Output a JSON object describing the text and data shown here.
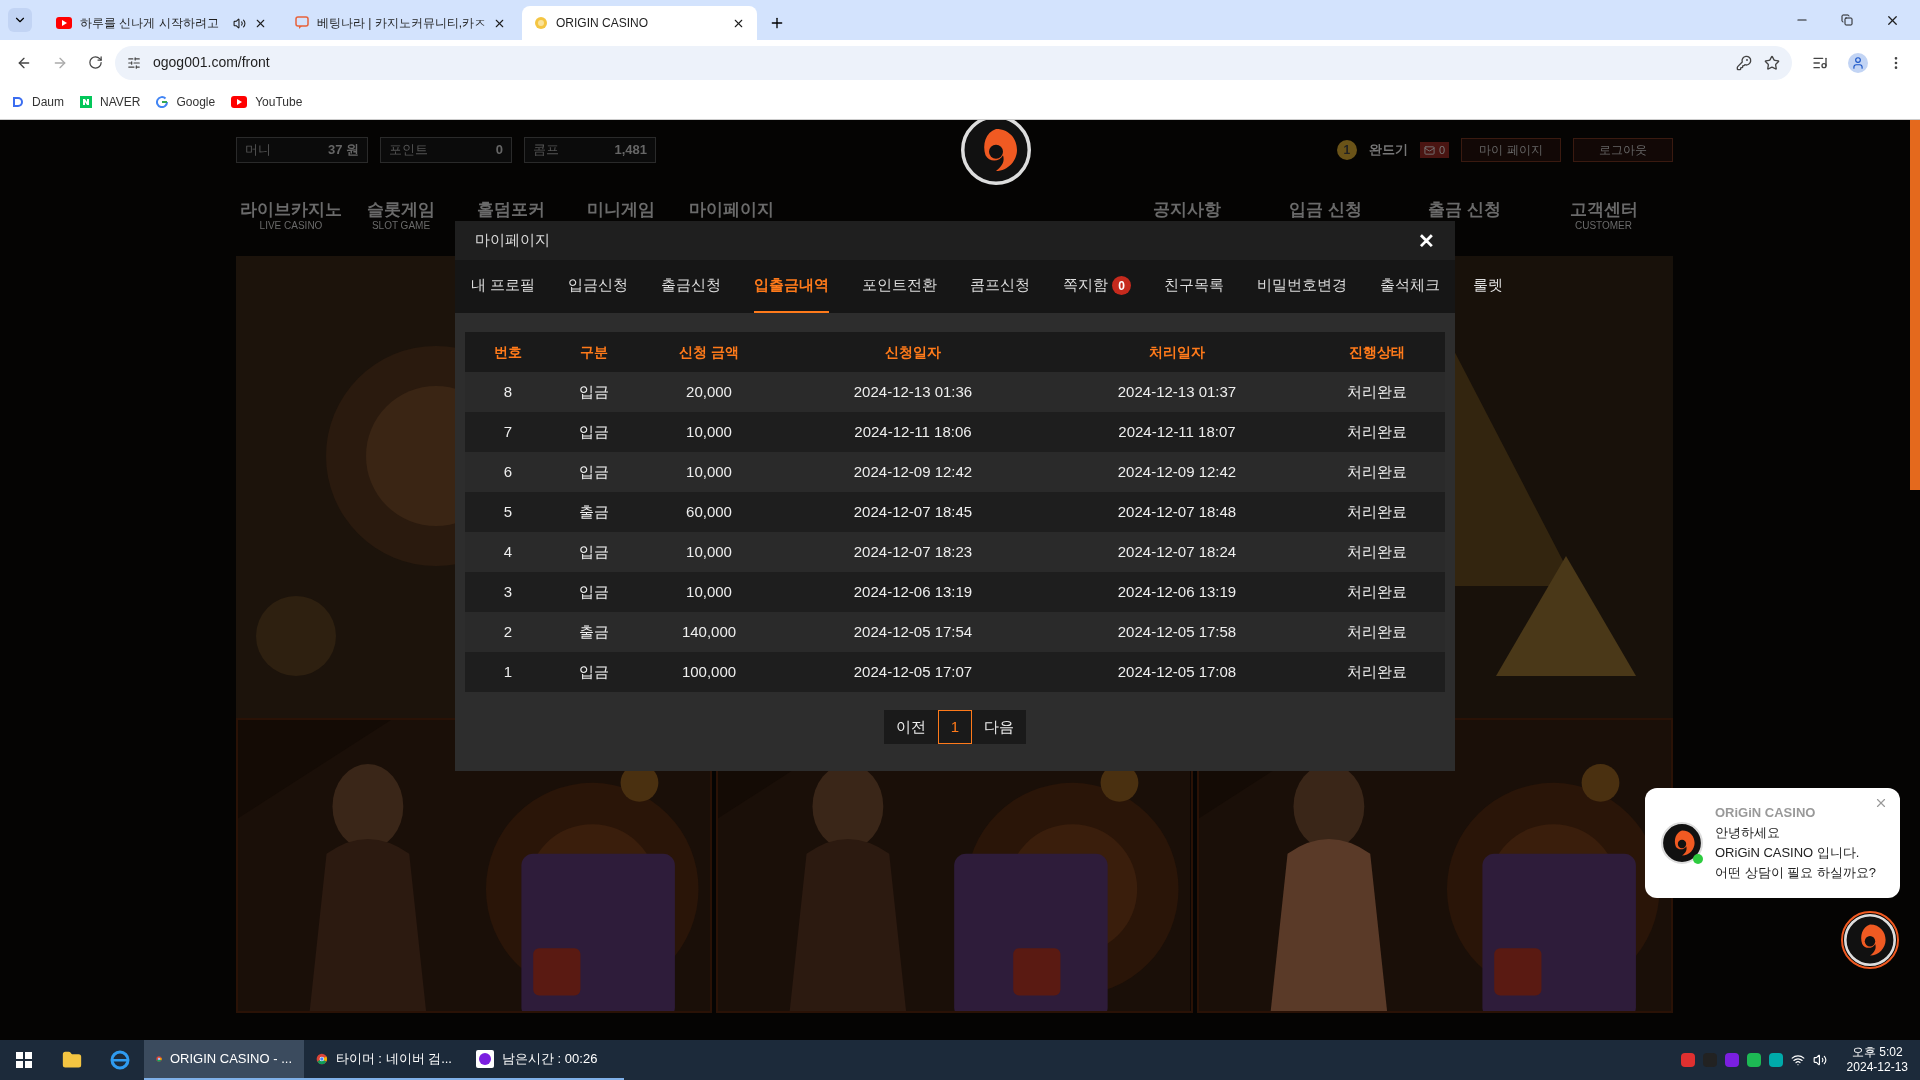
{
  "browser": {
    "tabs": [
      {
        "title": "하루를 신나게 시작하려고",
        "selected": false,
        "kind": "youtube",
        "audio": true
      },
      {
        "title": "베팅나라 | 카지노커뮤니티,카ㅈ",
        "selected": false,
        "kind": "chat",
        "audio": false
      },
      {
        "title": "ORIGIN CASINO",
        "selected": true,
        "kind": "globe",
        "audio": false
      }
    ],
    "url": "ogog001.com/front",
    "bookmarks": [
      {
        "label": "Daum",
        "kind": "daum"
      },
      {
        "label": "NAVER",
        "kind": "naver"
      },
      {
        "label": "Google",
        "kind": "google"
      },
      {
        "label": "YouTube",
        "kind": "youtube"
      }
    ]
  },
  "site": {
    "wallet": [
      {
        "label": "머니",
        "value": "37 원"
      },
      {
        "label": "포인트",
        "value": "0"
      },
      {
        "label": "콤프",
        "value": "1,481"
      }
    ],
    "user": {
      "level": "1",
      "name": "완드기",
      "messages": "0"
    },
    "account_buttons": [
      "마이 페이지",
      "로그아웃"
    ],
    "nav_left": [
      {
        "label": "라이브카지노",
        "sub": "LIVE CASINO"
      },
      {
        "label": "슬롯게임",
        "sub": "SLOT GAME"
      },
      {
        "label": "홀덤포커"
      },
      {
        "label": "미니게임"
      },
      {
        "label": "마이페이지"
      }
    ],
    "nav_right": [
      {
        "label": "공지사항"
      },
      {
        "label": "입금 신청"
      },
      {
        "label": "출금 신청"
      },
      {
        "label": "고객센터",
        "sub": "CUSTOMER"
      }
    ]
  },
  "modal": {
    "title": "마이페이지",
    "close": "✕",
    "tabs": [
      {
        "label": "내 프로필",
        "selected": false
      },
      {
        "label": "입금신청",
        "selected": false
      },
      {
        "label": "출금신청",
        "selected": false
      },
      {
        "label": "입출금내역",
        "selected": true
      },
      {
        "label": "포인트전환",
        "selected": false
      },
      {
        "label": "콤프신청",
        "selected": false
      },
      {
        "label": "쪽지함",
        "selected": false,
        "badge": "0"
      },
      {
        "label": "친구목록",
        "selected": false
      },
      {
        "label": "비밀번호변경",
        "selected": false
      },
      {
        "label": "출석체크",
        "selected": false
      },
      {
        "label": "룰렛",
        "selected": false
      }
    ],
    "table": {
      "columns": [
        "번호",
        "구분",
        "신청 금액",
        "신청일자",
        "처리일자",
        "진행상태"
      ],
      "rows": [
        [
          "8",
          "입금",
          "20,000",
          "2024-12-13 01:36",
          "2024-12-13 01:37",
          "처리완료"
        ],
        [
          "7",
          "입금",
          "10,000",
          "2024-12-11 18:06",
          "2024-12-11 18:07",
          "처리완료"
        ],
        [
          "6",
          "입금",
          "10,000",
          "2024-12-09 12:42",
          "2024-12-09 12:42",
          "처리완료"
        ],
        [
          "5",
          "출금",
          "60,000",
          "2024-12-07 18:45",
          "2024-12-07 18:48",
          "처리완료"
        ],
        [
          "4",
          "입금",
          "10,000",
          "2024-12-07 18:23",
          "2024-12-07 18:24",
          "처리완료"
        ],
        [
          "3",
          "입금",
          "10,000",
          "2024-12-06 13:19",
          "2024-12-06 13:19",
          "처리완료"
        ],
        [
          "2",
          "출금",
          "140,000",
          "2024-12-05 17:54",
          "2024-12-05 17:58",
          "처리완료"
        ],
        [
          "1",
          "입금",
          "100,000",
          "2024-12-05 17:07",
          "2024-12-05 17:08",
          "처리완료"
        ]
      ]
    },
    "pagination": {
      "prev": "이전",
      "pages": [
        {
          "label": "1",
          "selected": true
        }
      ],
      "next": "다음"
    }
  },
  "chat": {
    "name": "ORiGiN CASINO",
    "lines": [
      "안녕하세요",
      "ORiGiN CASINO 입니다.",
      "어떤 상담이 필요 하실까요?"
    ]
  },
  "taskbar": {
    "apps": [
      {
        "label": "ORIGIN CASINO - ...",
        "kind": "chrome",
        "selected": true
      },
      {
        "label": "타이머 : 네이버 검...",
        "kind": "chrome",
        "selected": false
      },
      {
        "label": "남은시간 : 00:26",
        "kind": "timer",
        "selected": false
      }
    ],
    "time": "오후 5:02",
    "date": "2024-12-13"
  }
}
